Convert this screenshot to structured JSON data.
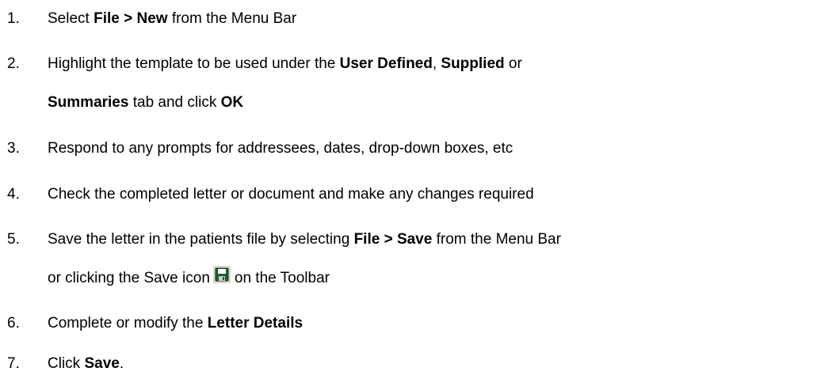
{
  "steps": [
    {
      "num": "1.",
      "t1": "Select ",
      "b1": "File > New",
      "t2": " from the Menu Bar"
    },
    {
      "num": "2.",
      "t1": "Highlight the template to be used under the ",
      "b1": "User Defined",
      "t2": ", ",
      "b2": "Supplied",
      "t3": " or",
      "b3": "Summaries",
      "t4": " tab and click ",
      "b4": "OK"
    },
    {
      "num": "3.",
      "t1": "Respond to any prompts for addressees, dates, drop-down boxes, etc"
    },
    {
      "num": "4.",
      "t1": "Check the completed letter or document and make any changes required"
    },
    {
      "num": "5.",
      "t1": "Save the letter in the patients file by selecting ",
      "b1": "File > Save",
      "t2": " from the Menu Bar",
      "t3": "or clicking the Save icon",
      "t4": "on the Toolbar",
      "icon": "save-disk-icon"
    },
    {
      "num": "6.",
      "t1": "Complete or modify the ",
      "b1": "Letter Details"
    },
    {
      "num": "7.",
      "t1": "Click ",
      "b1": "Save",
      "t2": "."
    }
  ],
  "colors": {
    "text": "#000000",
    "background": "#ffffff",
    "icon_disk": "#1a5e32",
    "icon_bg": "#dcd8cc"
  }
}
